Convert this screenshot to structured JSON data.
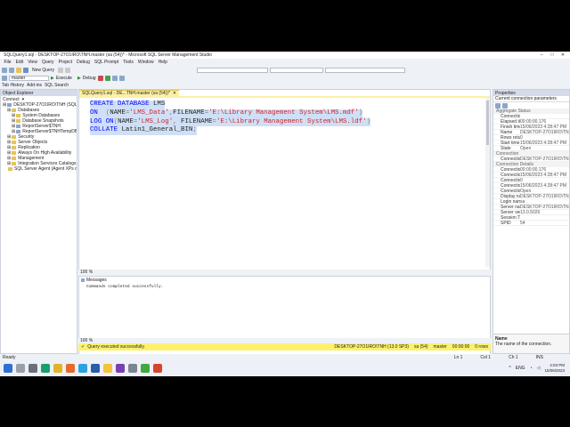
{
  "window": {
    "title": "SQLQuery1.sql - DESKTOP-27O1IRO\\TNH.master (sa (54))* - Microsoft SQL Server Management Studio"
  },
  "menu": [
    "File",
    "Edit",
    "View",
    "Query",
    "Project",
    "Debug",
    "SQL Prompt",
    "Tools",
    "Window",
    "Help"
  ],
  "toolbar": {
    "new_query_label": "New Query",
    "database_value": "master",
    "execute_label": "Execute",
    "debug_label": "Debug"
  },
  "toolbar3": [
    "Tab History",
    "Add-ins",
    "SQL Search"
  ],
  "object_explorer": {
    "title": "Object Explorer",
    "connect_label": "Connect",
    "tree": [
      {
        "label": "DESKTOP-27O1IRO\\TNH (SQL Server",
        "level": 0,
        "type": "server"
      },
      {
        "label": "Databases",
        "level": 1,
        "type": "folder"
      },
      {
        "label": "System Databases",
        "level": 2,
        "type": "folder"
      },
      {
        "label": "Database Snapshots",
        "level": 2,
        "type": "folder"
      },
      {
        "label": "ReportServer$TNH",
        "level": 2,
        "type": "db"
      },
      {
        "label": "ReportServer$TNHTempDB",
        "level": 2,
        "type": "db"
      },
      {
        "label": "Security",
        "level": 1,
        "type": "folder"
      },
      {
        "label": "Server Objects",
        "level": 1,
        "type": "folder"
      },
      {
        "label": "Replication",
        "level": 1,
        "type": "folder"
      },
      {
        "label": "Always On High Availability",
        "level": 1,
        "type": "folder"
      },
      {
        "label": "Management",
        "level": 1,
        "type": "folder"
      },
      {
        "label": "Integration Services Catalogs",
        "level": 1,
        "type": "folder"
      },
      {
        "label": "SQL Server Agent (Agent XPs disabl",
        "level": 1,
        "type": "agent"
      }
    ]
  },
  "editor": {
    "tab_label": "SQLQuery1.sql - DE...TNH.master (sa (54))*",
    "code_lines": [
      [
        {
          "t": "CREATE DATABASE ",
          "c": "kw"
        },
        {
          "t": "LMS",
          "c": "plain"
        }
      ],
      [
        {
          "t": "ON  ",
          "c": "kw"
        },
        {
          "t": "(",
          "c": "op"
        },
        {
          "t": "NAME",
          "c": "plain"
        },
        {
          "t": "=",
          "c": "op"
        },
        {
          "t": "'LMS_Data'",
          "c": "str"
        },
        {
          "t": ",",
          "c": "op"
        },
        {
          "t": "FILENAME",
          "c": "plain"
        },
        {
          "t": "=",
          "c": "op"
        },
        {
          "t": "'E:\\Library Management System\\LMS.mdf'",
          "c": "str"
        },
        {
          "t": ")",
          "c": "op"
        }
      ],
      [
        {
          "t": "LOG ON",
          "c": "kw"
        },
        {
          "t": "(",
          "c": "op"
        },
        {
          "t": "NAME",
          "c": "plain"
        },
        {
          "t": "=",
          "c": "op"
        },
        {
          "t": "'LMS_Log'",
          "c": "str"
        },
        {
          "t": ", ",
          "c": "op"
        },
        {
          "t": "FILENAME",
          "c": "plain"
        },
        {
          "t": "=",
          "c": "op"
        },
        {
          "t": "'E:\\Library Management System\\LMS.ldf'",
          "c": "str"
        },
        {
          "t": ")",
          "c": "op"
        }
      ],
      [
        {
          "t": "COLLATE ",
          "c": "kw"
        },
        {
          "t": "Latin1_General_BIN",
          "c": "plain"
        },
        {
          "t": ";",
          "c": "op"
        }
      ]
    ],
    "zoom": "100 %"
  },
  "results": {
    "tab_label": "Messages",
    "message": "Commands completed successfully.",
    "zoom": "100 %"
  },
  "query_status": {
    "message": "Query executed successfully.",
    "server": "DESKTOP-27O1IRO\\TNH (13.0 SP3)",
    "user": "sa (54)",
    "database": "master",
    "time": "00:00:00",
    "rows": "0 rows"
  },
  "properties": {
    "title": "Properties",
    "object": "Current connection parameters",
    "categories": [
      {
        "name": "Aggregate Status",
        "rows": [
          {
            "k": "Connection failure",
            "v": ""
          },
          {
            "k": "Elapsed time",
            "v": "00:00:00.176"
          },
          {
            "k": "Finish time",
            "v": "15/06/2023 4:28:47 PM"
          },
          {
            "k": "Name",
            "v": "DESKTOP-27O1IRO\\TNH"
          },
          {
            "k": "Rows returned",
            "v": "0"
          },
          {
            "k": "Start time",
            "v": "15/06/2023 4:28:47 PM"
          },
          {
            "k": "State",
            "v": "Open"
          }
        ]
      },
      {
        "name": "Connection",
        "rows": [
          {
            "k": "Connection name",
            "v": "DESKTOP-27O1IRO\\TNH"
          }
        ]
      },
      {
        "name": "Connection Details",
        "rows": [
          {
            "k": "Connection elapsed",
            "v": "00:00:00.176"
          },
          {
            "k": "Connection finish",
            "v": "15/06/2023 4:28:47 PM"
          },
          {
            "k": "Connection rows",
            "v": "0"
          },
          {
            "k": "Connection start",
            "v": "15/06/2023 4:28:47 PM"
          },
          {
            "k": "Connection state",
            "v": "Open"
          },
          {
            "k": "Display name",
            "v": "DESKTOP-27O1IRO\\TNH"
          },
          {
            "k": "Login name",
            "v": "sa"
          },
          {
            "k": "Server name",
            "v": "DESKTOP-27O1IRO\\TNH"
          },
          {
            "k": "Server version",
            "v": "13.0.5026"
          },
          {
            "k": "Session Tracing ID",
            "v": ""
          },
          {
            "k": "SPID",
            "v": "54"
          }
        ]
      }
    ],
    "desc_title": "Name",
    "desc_text": "The name of the connection."
  },
  "statusbar": {
    "left": "Ready",
    "ln": "Ln 1",
    "col": "Col 1",
    "ch": "Ch 1",
    "mode": "INS"
  },
  "taskbar": {
    "icons": [
      {
        "name": "start",
        "color": "#2f6fd1"
      },
      {
        "name": "search",
        "color": "#9aa0aa"
      },
      {
        "name": "task-view",
        "color": "#6a6f78"
      },
      {
        "name": "edge",
        "color": "#1a9e6e"
      },
      {
        "name": "chrome",
        "color": "#e0b32b"
      },
      {
        "name": "firefox",
        "color": "#e66a2b"
      },
      {
        "name": "telegram",
        "color": "#2aa3e0"
      },
      {
        "name": "word",
        "color": "#2b5cab"
      },
      {
        "name": "explorer",
        "color": "#f2c33b"
      },
      {
        "name": "visual-studio",
        "color": "#7a3fb0"
      },
      {
        "name": "ssms",
        "color": "#7d8590"
      },
      {
        "name": "camtasia-green",
        "color": "#3fa840"
      },
      {
        "name": "camtasia-red",
        "color": "#d8442b"
      }
    ],
    "lang": "ENG",
    "time": "4:03 PM",
    "date": "15/06/2023"
  }
}
